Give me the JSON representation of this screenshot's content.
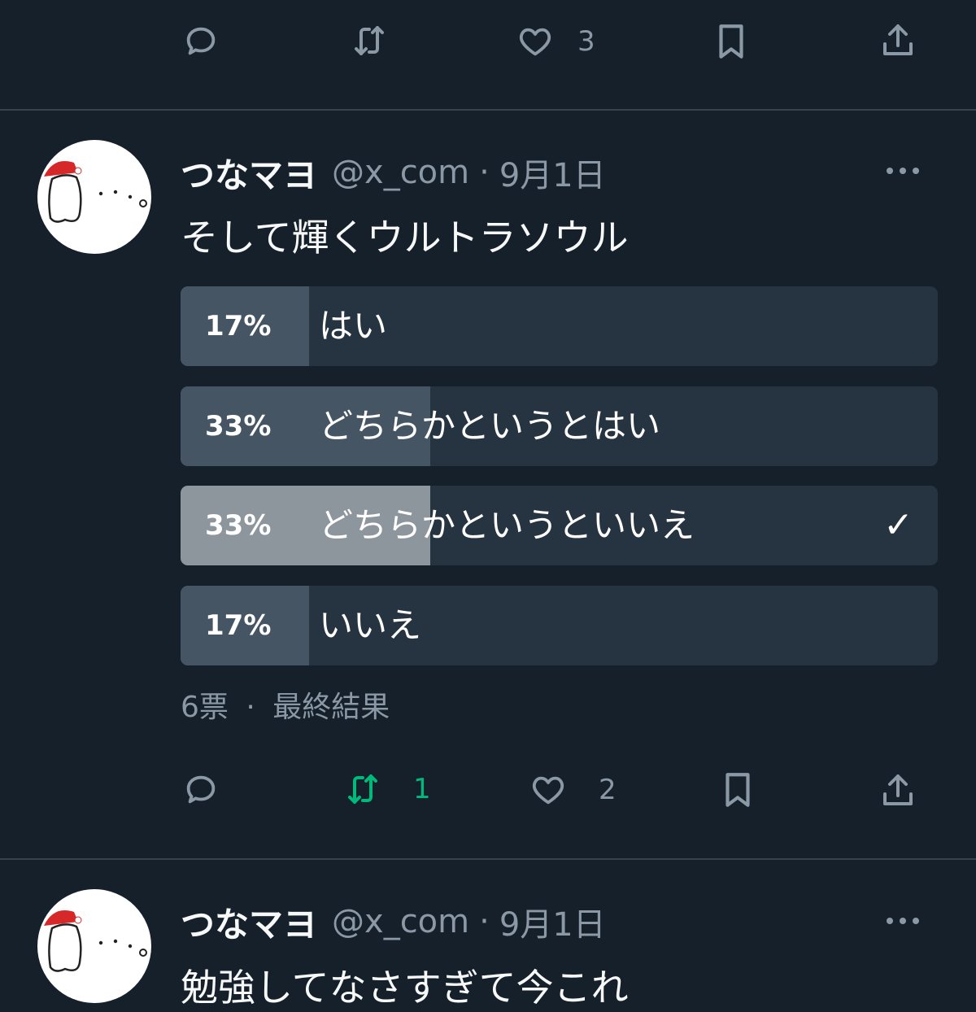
{
  "top_actions": {
    "like_count": "3"
  },
  "tweets": [
    {
      "name": "つなマヨ",
      "handle": "@x_com",
      "separator": "·",
      "time": "9月1日",
      "text": "そして輝くウルトラソウル",
      "poll": {
        "options": [
          {
            "percent_label": "17%",
            "label": "はい",
            "fraction": 0.17,
            "chosen": false
          },
          {
            "percent_label": "33%",
            "label": "どちらかというとはい",
            "fraction": 0.33,
            "chosen": false
          },
          {
            "percent_label": "33%",
            "label": "どちらかというといいえ",
            "fraction": 0.33,
            "chosen": true,
            "check": "✓"
          },
          {
            "percent_label": "17%",
            "label": "いいえ",
            "fraction": 0.17,
            "chosen": false
          }
        ],
        "votes": "6票",
        "separator": "·",
        "status": "最終結果"
      },
      "actions": {
        "retweet_count": "1",
        "like_count": "2",
        "retweet_active_color": "#00ba7c"
      }
    },
    {
      "name": "つなマヨ",
      "handle": "@x_com",
      "separator": "·",
      "time": "9月1日",
      "text": "勉強してなさすぎて今これ"
    }
  ],
  "icons": [
    "reply-icon",
    "retweet-icon",
    "like-icon",
    "bookmark-icon",
    "share-icon",
    "more-icon",
    "check-icon"
  ]
}
